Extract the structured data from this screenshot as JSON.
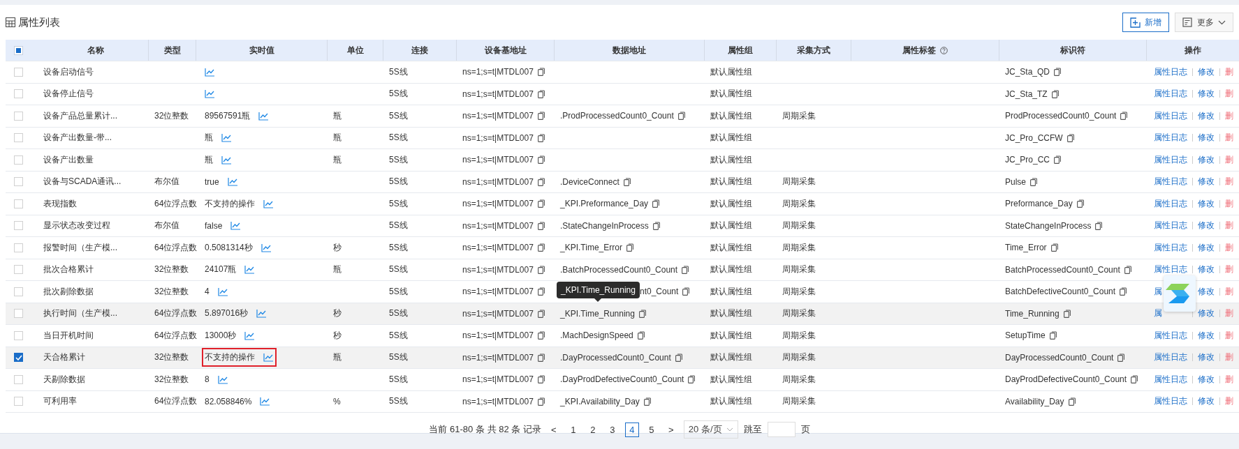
{
  "panel": {
    "title": "属性列表",
    "buttons": [
      {
        "label": "新增",
        "kind": "add"
      },
      {
        "label": "更多",
        "kind": "more"
      }
    ]
  },
  "select_all": {
    "indeterminate": true
  },
  "columns": [
    "名称",
    "类型",
    "实时值",
    "单位",
    "连接",
    "设备基地址",
    "数据地址",
    "属性组",
    "采集方式",
    "属性标签",
    "标识符",
    "操作"
  ],
  "rows": [
    {
      "checked": false,
      "hovered": false,
      "name": "设备启动信号",
      "connection": "5S线",
      "base_address": "ns=1;s=t|MTDL007",
      "group": "默认属性组",
      "identifier": "JC_Sta_QD",
      "actions": [
        {
          "label": "属性日志",
          "kind": "log"
        },
        {
          "label": "修改",
          "kind": "edit"
        },
        {
          "label": "删",
          "kind": "delete"
        }
      ]
    },
    {
      "checked": false,
      "hovered": false,
      "name": "设备停止信号",
      "connection": "5S线",
      "base_address": "ns=1;s=t|MTDL007",
      "group": "默认属性组",
      "identifier": "JC_Sta_TZ",
      "actions": [
        {
          "label": "属性日志",
          "kind": "log"
        },
        {
          "label": "修改",
          "kind": "edit"
        },
        {
          "label": "删",
          "kind": "delete"
        }
      ]
    },
    {
      "checked": false,
      "hovered": false,
      "name": "设备产品总量累计...",
      "type": "32位整数",
      "value": "89567591瓶",
      "unit": "瓶",
      "connection": "5S线",
      "base_address": "ns=1;s=t|MTDL007",
      "data_address": ".ProdProcessedCount0_Count",
      "group": "默认属性组",
      "collection": "周期采集",
      "identifier": "ProdProcessedCount0_Count",
      "actions": [
        {
          "label": "属性日志",
          "kind": "log"
        },
        {
          "label": "修改",
          "kind": "edit"
        },
        {
          "label": "删",
          "kind": "delete"
        }
      ]
    },
    {
      "checked": false,
      "hovered": false,
      "name": "设备产出数量-带...",
      "value": "瓶",
      "unit": "瓶",
      "connection": "5S线",
      "base_address": "ns=1;s=t|MTDL007",
      "group": "默认属性组",
      "identifier": "JC_Pro_CCFW",
      "actions": [
        {
          "label": "属性日志",
          "kind": "log"
        },
        {
          "label": "修改",
          "kind": "edit"
        },
        {
          "label": "删",
          "kind": "delete"
        }
      ]
    },
    {
      "checked": false,
      "hovered": false,
      "name": "设备产出数量",
      "value": "瓶",
      "unit": "瓶",
      "connection": "5S线",
      "base_address": "ns=1;s=t|MTDL007",
      "group": "默认属性组",
      "identifier": "JC_Pro_CC",
      "actions": [
        {
          "label": "属性日志",
          "kind": "log"
        },
        {
          "label": "修改",
          "kind": "edit"
        },
        {
          "label": "删",
          "kind": "delete"
        }
      ]
    },
    {
      "checked": false,
      "hovered": false,
      "name": "设备与SCADA通讯...",
      "type": "布尔值",
      "value": "true",
      "connection": "5S线",
      "base_address": "ns=1;s=t|MTDL007",
      "data_address": ".DeviceConnect",
      "group": "默认属性组",
      "collection": "周期采集",
      "identifier": "Pulse",
      "actions": [
        {
          "label": "属性日志",
          "kind": "log"
        },
        {
          "label": "修改",
          "kind": "edit"
        },
        {
          "label": "删",
          "kind": "delete"
        }
      ]
    },
    {
      "checked": false,
      "hovered": false,
      "name": "表现指数",
      "type": "64位浮点数",
      "value": "不支持的操作",
      "connection": "5S线",
      "base_address": "ns=1;s=t|MTDL007",
      "data_address": "_KPI.Preformance_Day",
      "group": "默认属性组",
      "collection": "周期采集",
      "identifier": "Preformance_Day",
      "actions": [
        {
          "label": "属性日志",
          "kind": "log"
        },
        {
          "label": "修改",
          "kind": "edit"
        },
        {
          "label": "删",
          "kind": "delete"
        }
      ]
    },
    {
      "checked": false,
      "hovered": false,
      "name": "显示状态改变过程",
      "type": "布尔值",
      "value": "false",
      "connection": "5S线",
      "base_address": "ns=1;s=t|MTDL007",
      "data_address": ".StateChangeInProcess",
      "group": "默认属性组",
      "collection": "周期采集",
      "identifier": "StateChangeInProcess",
      "actions": [
        {
          "label": "属性日志",
          "kind": "log"
        },
        {
          "label": "修改",
          "kind": "edit"
        },
        {
          "label": "删",
          "kind": "delete"
        }
      ]
    },
    {
      "checked": false,
      "hovered": false,
      "name": "报警时间（生产模...",
      "type": "64位浮点数",
      "value": "0.5081314秒",
      "unit": "秒",
      "connection": "5S线",
      "base_address": "ns=1;s=t|MTDL007",
      "data_address": "_KPI.Time_Error",
      "group": "默认属性组",
      "collection": "周期采集",
      "identifier": "Time_Error",
      "actions": [
        {
          "label": "属性日志",
          "kind": "log"
        },
        {
          "label": "修改",
          "kind": "edit"
        },
        {
          "label": "删",
          "kind": "delete"
        }
      ]
    },
    {
      "checked": false,
      "hovered": false,
      "name": "批次合格累计",
      "type": "32位整数",
      "value": "24107瓶",
      "unit": "瓶",
      "connection": "5S线",
      "base_address": "ns=1;s=t|MTDL007",
      "data_address": ".BatchProcessedCount0_Count",
      "group": "默认属性组",
      "collection": "周期采集",
      "identifier": "BatchProcessedCount0_Count",
      "actions": [
        {
          "label": "属性日志",
          "kind": "log"
        },
        {
          "label": "修改",
          "kind": "edit"
        },
        {
          "label": "删",
          "kind": "delete"
        }
      ]
    },
    {
      "checked": false,
      "hovered": false,
      "name": "批次剔除数据",
      "type": "32位整数",
      "value": "4",
      "connection": "5S线",
      "base_address": "ns=1;s=t|MTDL007",
      "tooltip": "_KPI.Time_Running",
      "data_address": "nt0_Count",
      "group": "默认属性组",
      "collection": "周期采集",
      "identifier": "BatchDefectiveCount0_Count",
      "actions": [
        {
          "label": "属",
          "kind": "log"
        },
        {
          "label": "修改",
          "kind": "edit"
        },
        {
          "label": "删",
          "kind": "delete"
        }
      ]
    },
    {
      "checked": false,
      "hovered": true,
      "name": "执行时间（生产模...",
      "type": "64位浮点数",
      "value": "5.897016秒",
      "unit": "秒",
      "connection": "5S线",
      "base_address": "ns=1;s=t|MTDL007",
      "data_address": "_KPI.Time_Running",
      "group": "默认属性组",
      "collection": "周期采集",
      "identifier": "Time_Running",
      "actions": [
        {
          "label": "属",
          "kind": "log"
        },
        {
          "label": "修改",
          "kind": "edit"
        },
        {
          "label": "删",
          "kind": "delete"
        }
      ]
    },
    {
      "checked": false,
      "hovered": false,
      "name": "当日开机时间",
      "type": "64位浮点数",
      "value": "13000秒",
      "unit": "秒",
      "connection": "5S线",
      "base_address": "ns=1;s=t|MTDL007",
      "data_address": ".MachDesignSpeed",
      "group": "默认属性组",
      "collection": "周期采集",
      "identifier": "SetupTime",
      "actions": [
        {
          "label": "属性日志",
          "kind": "log"
        },
        {
          "label": "修改",
          "kind": "edit"
        },
        {
          "label": "删",
          "kind": "delete"
        }
      ]
    },
    {
      "checked": true,
      "hovered": false,
      "highlighted": true,
      "name": "天合格累计",
      "type": "32位整数",
      "value": "不支持的操作",
      "unit": "瓶",
      "connection": "5S线",
      "base_address": "ns=1;s=t|MTDL007",
      "data_address": ".DayProcessedCount0_Count",
      "group": "默认属性组",
      "collection": "周期采集",
      "identifier": "DayProcessedCount0_Count",
      "actions": [
        {
          "label": "属性日志",
          "kind": "log"
        },
        {
          "label": "修改",
          "kind": "edit"
        },
        {
          "label": "删",
          "kind": "delete"
        }
      ]
    },
    {
      "checked": false,
      "hovered": false,
      "name": "天剔除数据",
      "type": "32位整数",
      "value": "8",
      "connection": "5S线",
      "base_address": "ns=1;s=t|MTDL007",
      "data_address": ".DayProdDefectiveCount0_Count",
      "group": "默认属性组",
      "collection": "周期采集",
      "identifier": "DayProdDefectiveCount0_Count",
      "actions": [
        {
          "label": "属性日志",
          "kind": "log"
        },
        {
          "label": "修改",
          "kind": "edit"
        },
        {
          "label": "删",
          "kind": "delete"
        }
      ]
    },
    {
      "checked": false,
      "hovered": false,
      "name": "可利用率",
      "type": "64位浮点数",
      "value": "82.058846%",
      "unit": "%",
      "connection": "5S线",
      "base_address": "ns=1;s=t|MTDL007",
      "data_address": "_KPI.Availability_Day",
      "group": "默认属性组",
      "collection": "周期采集",
      "identifier": "Availability_Day",
      "actions": [
        {
          "label": "属性日志",
          "kind": "log"
        },
        {
          "label": "修改",
          "kind": "edit"
        },
        {
          "label": "删",
          "kind": "delete"
        }
      ]
    }
  ],
  "pagination": {
    "summary": "当前 61-80 条 共 82 条 记录",
    "prev": "<",
    "next": ">",
    "pages": [
      {
        "label": "1",
        "selected": false
      },
      {
        "label": "2",
        "selected": false
      },
      {
        "label": "3",
        "selected": false
      },
      {
        "label": "4",
        "selected": true
      },
      {
        "label": "5",
        "selected": false
      }
    ],
    "page_size": "20 条/页",
    "jump_label": "跳至",
    "jump_suffix": "页"
  }
}
